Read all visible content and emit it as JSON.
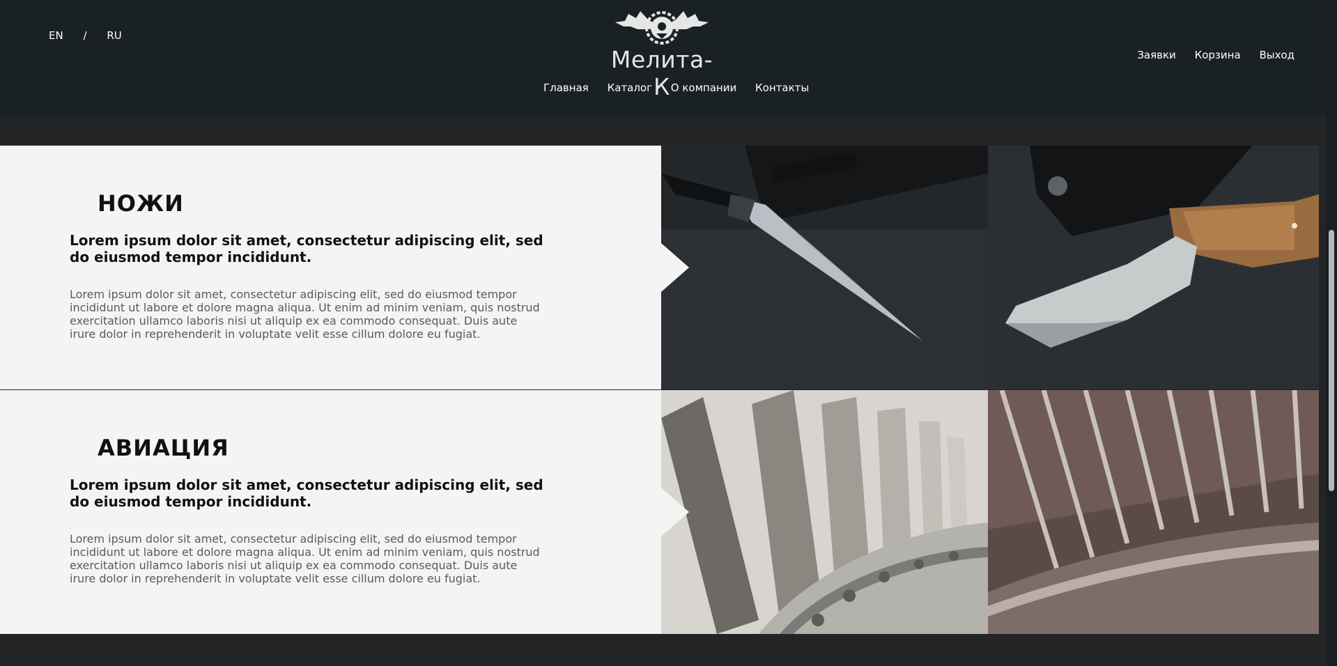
{
  "header": {
    "languages": [
      "EN",
      "RU"
    ],
    "lang_separator": "/",
    "logo_text": "Мелита-К",
    "main_nav": [
      "Главная",
      "Каталог",
      "О компании",
      "Контакты"
    ],
    "user_nav": [
      "Заявки",
      "Корзина",
      "Выход"
    ]
  },
  "sections": [
    {
      "title": "НОЖИ",
      "subtitle": "Lorem ipsum dolor sit amet, consectetur adipiscing elit, sed do eiusmod tempor incididunt.",
      "body": "Lorem ipsum dolor sit amet, consectetur adipiscing elit, sed do eiusmod tempor incididunt ut labore et dolore magna aliqua. Ut enim ad minim veniam, quis nostrud exercitation ullamco laboris nisi ut aliquip ex ea commodo consequat. Duis aute irure dolor in reprehenderit in voluptate velit esse cillum dolore eu fugiat.",
      "images": [
        "dagger-knife-photo",
        "hunting-knife-photo"
      ]
    },
    {
      "title": "АВИАЦИЯ",
      "subtitle": "Lorem ipsum dolor sit amet, consectetur adipiscing elit, sed do eiusmod tempor incididunt.",
      "body": "Lorem ipsum dolor sit amet, consectetur adipiscing elit, sed do eiusmod tempor incididunt ut labore et dolore magna aliqua. Ut enim ad minim veniam, quis nostrud exercitation ullamco laboris nisi ut aliquip ex ea commodo consequat. Duis aute irure dolor in reprehenderit in voluptate velit esse cillum dolore eu fugiat.",
      "images": [
        "turbine-blades-photo",
        "turbine-disk-photo"
      ]
    }
  ],
  "colors": {
    "header_bg": "#1a2125",
    "page_bg": "#232425",
    "section_bg": "#f4f4f4",
    "title_text": "#111111",
    "body_text": "#5a5a5a"
  }
}
